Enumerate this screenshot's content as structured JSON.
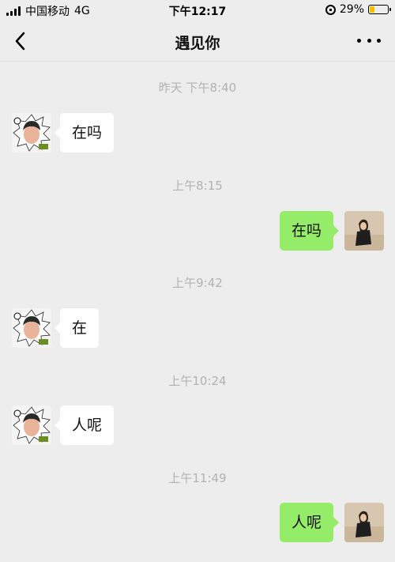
{
  "status_bar": {
    "carrier": "中国移动",
    "network": "4G",
    "time": "下午12:17",
    "battery": "29%",
    "battery_level": 0.29,
    "accent_battery": "#f2c200"
  },
  "nav": {
    "back_icon": "chevron-left-icon",
    "title": "遇见你",
    "more_icon": "more-dots-icon"
  },
  "chat": {
    "timestamps": [
      "昨天 下午8:40",
      "上午8:15",
      "上午9:42",
      "上午10:24",
      "上午11:49"
    ],
    "messages": [
      {
        "side": "incoming",
        "text": "在吗"
      },
      {
        "side": "outgoing",
        "text": "在吗"
      },
      {
        "side": "incoming",
        "text": "在"
      },
      {
        "side": "incoming",
        "text": "人呢"
      },
      {
        "side": "outgoing",
        "text": "人呢"
      }
    ],
    "colors": {
      "background": "#ededed",
      "incoming_bubble": "#ffffff",
      "outgoing_bubble": "#95ec69",
      "timestamp_text": "#b2b2b2"
    }
  }
}
